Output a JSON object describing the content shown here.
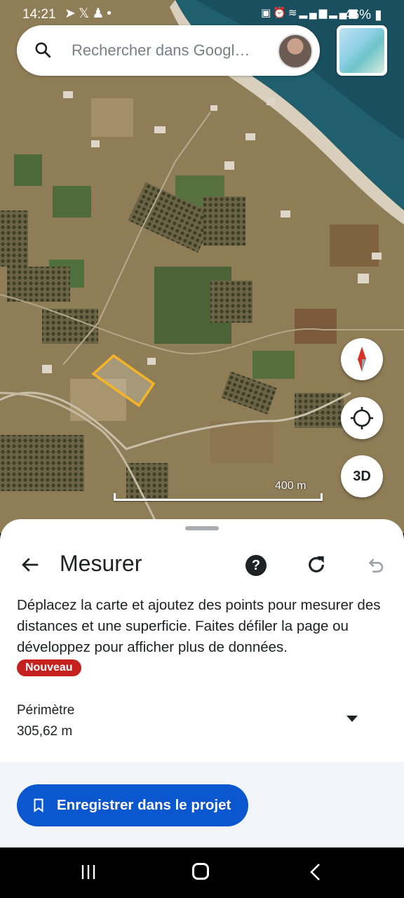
{
  "status_bar": {
    "time": "14:21",
    "left_icons": [
      "telegram-icon",
      "x-icon",
      "app-icon",
      "dot-icon"
    ],
    "right_icons": [
      "lock-icon",
      "alarm-icon",
      "wifi-icon",
      "signal-icon",
      "signal-icon"
    ],
    "battery": "46%"
  },
  "search": {
    "placeholder": "Rechercher dans Googl…",
    "icon": "search-icon"
  },
  "map": {
    "scale_label": "400 m",
    "button_3d": "3D",
    "polygon_color": "#f5b426"
  },
  "sheet": {
    "title": "Mesurer",
    "help": "?",
    "description": "Déplacez la carte et ajoutez des points pour mesurer des distances et une superficie. Faites défiler la page ou développez pour afficher plus de données.",
    "badge": "Nouveau",
    "metric_label": "Périmètre",
    "metric_value": "305,62 m",
    "save_button": "Enregistrer dans le projet"
  },
  "colors": {
    "accent": "#0b57d0",
    "badge": "#c5221f"
  }
}
